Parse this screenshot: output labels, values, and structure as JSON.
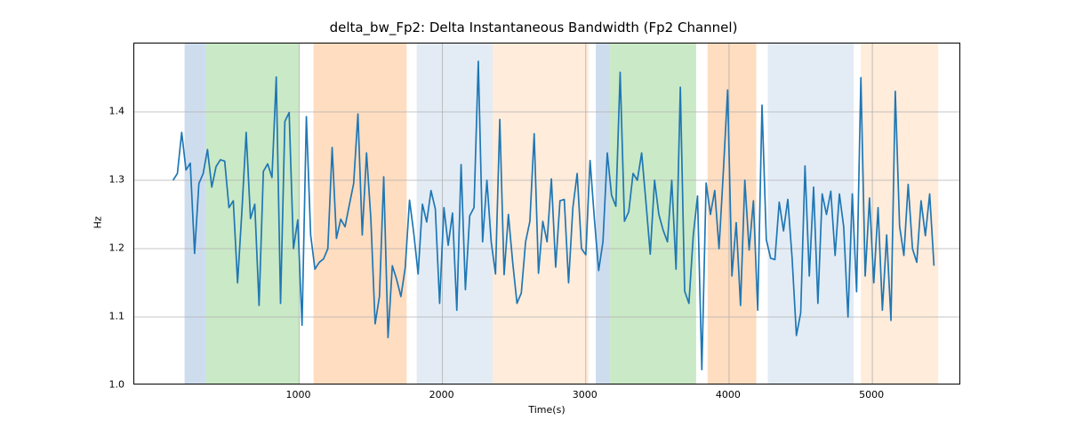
{
  "chart_data": {
    "type": "line",
    "title": "delta_bw_Fp2: Delta Instantaneous Bandwidth (Fp2 Channel)",
    "xlabel": "Time(s)",
    "ylabel": "Hz",
    "xlim": [
      -151,
      5620
    ],
    "ylim": [
      1.0,
      1.5
    ],
    "xticks": [
      1000,
      2000,
      3000,
      4000,
      5000
    ],
    "yticks": [
      1.0,
      1.1,
      1.2,
      1.3,
      1.4
    ],
    "x_start": 120,
    "x_step": 30,
    "values": [
      1.3,
      1.31,
      1.37,
      1.315,
      1.325,
      1.193,
      1.295,
      1.31,
      1.345,
      1.29,
      1.32,
      1.33,
      1.328,
      1.26,
      1.27,
      1.15,
      1.254,
      1.37,
      1.244,
      1.265,
      1.117,
      1.313,
      1.324,
      1.304,
      1.451,
      1.12,
      1.386,
      1.399,
      1.2,
      1.242,
      1.088,
      1.393,
      1.22,
      1.17,
      1.18,
      1.185,
      1.2,
      1.348,
      1.215,
      1.243,
      1.232,
      1.264,
      1.295,
      1.397,
      1.22,
      1.34,
      1.244,
      1.09,
      1.13,
      1.305,
      1.07,
      1.175,
      1.155,
      1.13,
      1.172,
      1.271,
      1.222,
      1.163,
      1.265,
      1.239,
      1.285,
      1.258,
      1.12,
      1.26,
      1.205,
      1.252,
      1.11,
      1.323,
      1.14,
      1.248,
      1.26,
      1.474,
      1.21,
      1.3,
      1.21,
      1.163,
      1.389,
      1.162,
      1.25,
      1.18,
      1.12,
      1.135,
      1.21,
      1.24,
      1.368,
      1.164,
      1.24,
      1.21,
      1.302,
      1.173,
      1.27,
      1.272,
      1.15,
      1.26,
      1.31,
      1.2,
      1.191,
      1.329,
      1.244,
      1.168,
      1.21,
      1.34,
      1.278,
      1.262,
      1.458,
      1.24,
      1.254,
      1.31,
      1.3,
      1.34,
      1.268,
      1.192,
      1.3,
      1.25,
      1.227,
      1.21,
      1.3,
      1.17,
      1.436,
      1.138,
      1.12,
      1.219,
      1.277,
      1.023,
      1.296,
      1.25,
      1.285,
      1.2,
      1.312,
      1.432,
      1.16,
      1.238,
      1.117,
      1.3,
      1.198,
      1.27,
      1.11,
      1.41,
      1.213,
      1.186,
      1.184,
      1.268,
      1.226,
      1.272,
      1.186,
      1.073,
      1.106,
      1.321,
      1.16,
      1.29,
      1.12,
      1.28,
      1.25,
      1.284,
      1.19,
      1.28,
      1.232,
      1.1,
      1.28,
      1.137,
      1.45,
      1.16,
      1.274,
      1.15,
      1.26,
      1.11,
      1.22,
      1.095,
      1.43,
      1.233,
      1.19,
      1.294,
      1.2,
      1.18,
      1.27,
      1.219,
      1.28,
      1.175
    ],
    "line_color": "#1f77b4",
    "grid_color": "#b0b0b0",
    "regions": [
      {
        "x0": 200,
        "x1": 350,
        "color": "rgba(114,158,206,0.35)"
      },
      {
        "x0": 350,
        "x1": 1000,
        "color": "rgba(103,191,92,0.35)"
      },
      {
        "x0": 1100,
        "x1": 1750,
        "color": "rgba(255,158,74,0.35)"
      },
      {
        "x0": 1820,
        "x1": 2350,
        "color": "rgba(114,158,206,0.20)"
      },
      {
        "x0": 2350,
        "x1": 3020,
        "color": "rgba(255,158,74,0.20)"
      },
      {
        "x0": 3070,
        "x1": 3170,
        "color": "rgba(114,158,206,0.35)"
      },
      {
        "x0": 3170,
        "x1": 3770,
        "color": "rgba(103,191,92,0.35)"
      },
      {
        "x0": 3850,
        "x1": 4190,
        "color": "rgba(255,158,74,0.35)"
      },
      {
        "x0": 4270,
        "x1": 4870,
        "color": "rgba(114,158,206,0.20)"
      },
      {
        "x0": 4870,
        "x1": 4920,
        "color": "rgba(255,255,255,0.0)"
      },
      {
        "x0": 4920,
        "x1": 5460,
        "color": "rgba(255,158,74,0.20)"
      }
    ]
  }
}
